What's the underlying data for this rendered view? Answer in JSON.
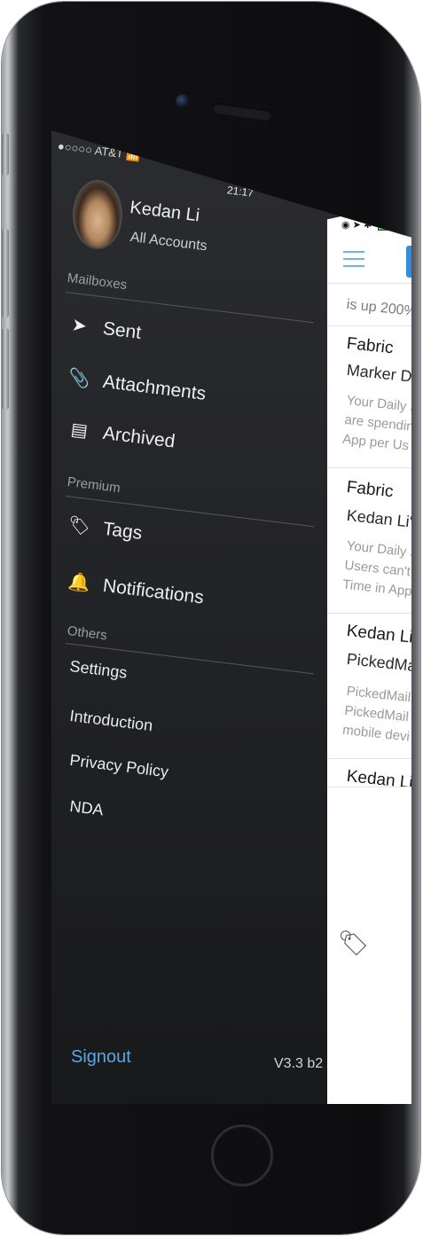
{
  "status": {
    "carrier": "●○○○○ AT&T",
    "wifi": "wifi-icon",
    "time": "21:17"
  },
  "user": {
    "name": "Kedan Li",
    "subtitle": "All Accounts"
  },
  "sections": {
    "mailboxes": "Mailboxes",
    "premium": "Premium",
    "others": "Others"
  },
  "mailbox_items": [
    {
      "label": "Sent",
      "icon": "send-icon",
      "glyph": "➤"
    },
    {
      "label": "Attachments",
      "icon": "paperclip-icon",
      "glyph": "📎"
    },
    {
      "label": "Archived",
      "icon": "archive-icon",
      "glyph": "▤"
    }
  ],
  "premium_items": [
    {
      "label": "Tags",
      "icon": "tag-icon",
      "glyph": "🏷"
    },
    {
      "label": "Notifications",
      "icon": "bell-icon",
      "glyph": "🔔"
    }
  ],
  "other_items": [
    "Settings",
    "Introduction",
    "Privacy Policy",
    "NDA"
  ],
  "footer": {
    "signout": "Signout",
    "version": "V3.3 b2"
  },
  "peek": {
    "first_line": "is up 200%",
    "emails": [
      {
        "sender": "Fabric",
        "subject": "Marker Da",
        "preview": [
          "Your Daily S",
          "are spendin",
          "App per Us"
        ]
      },
      {
        "sender": "Fabric",
        "subject": "Kedan Li's",
        "preview": [
          "Your Daily S",
          "Users can't",
          "Time in App"
        ]
      },
      {
        "sender": "Kedan Li'",
        "subject": "PickedMai",
        "preview": [
          "PickedMail",
          "PickedMail",
          "mobile devi"
        ]
      },
      {
        "sender": "Kedan Li'"
      }
    ],
    "floating_icon": "tag-icon"
  }
}
